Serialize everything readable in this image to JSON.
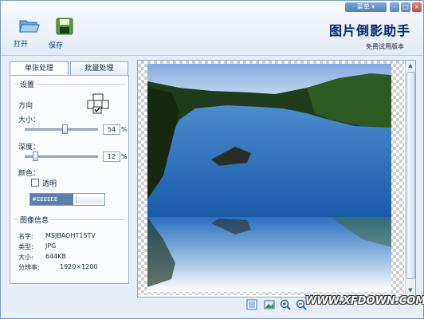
{
  "toolbar": {
    "open_label": "打开",
    "save_label": "保存",
    "menu_label": "菜单"
  },
  "brand": {
    "title": "图片倒影助手",
    "subtitle": "免费试用版本"
  },
  "tabs": [
    {
      "label": "单张处理"
    },
    {
      "label": "批量处理"
    }
  ],
  "settings": {
    "group_title": "设置",
    "direction_label": "方向",
    "size_label": "大小：",
    "size_value": "54",
    "depth_label": "深度：",
    "depth_value": "12",
    "percent": "%",
    "color_label": "颜色：",
    "transparent_label": "透明",
    "color_value": "#EEEEEE"
  },
  "slider_levels": {
    "size": 0.54,
    "depth": 0.12
  },
  "info": {
    "group_title": "图像信息",
    "rows": [
      {
        "label": "名字:",
        "value": "MSJBAOHT15TV"
      },
      {
        "label": "类型:",
        "value": "JPG"
      },
      {
        "label": "大小:",
        "value": "644KB"
      },
      {
        "label": "分辨率:",
        "value": "1920×1200"
      }
    ]
  },
  "icons": {
    "open": "folder-open-icon",
    "save": "floppy-save-icon",
    "fit": "fit-view-icon",
    "image": "image-icon",
    "zoom_in": "zoom-in-icon",
    "zoom_out": "zoom-out-icon"
  },
  "watermark": "WWW.XFDOWN.COM",
  "colors": {
    "accent": "#4f7fb9",
    "brand": "#0d2d6b",
    "panel_border": "#9bb2cc"
  }
}
